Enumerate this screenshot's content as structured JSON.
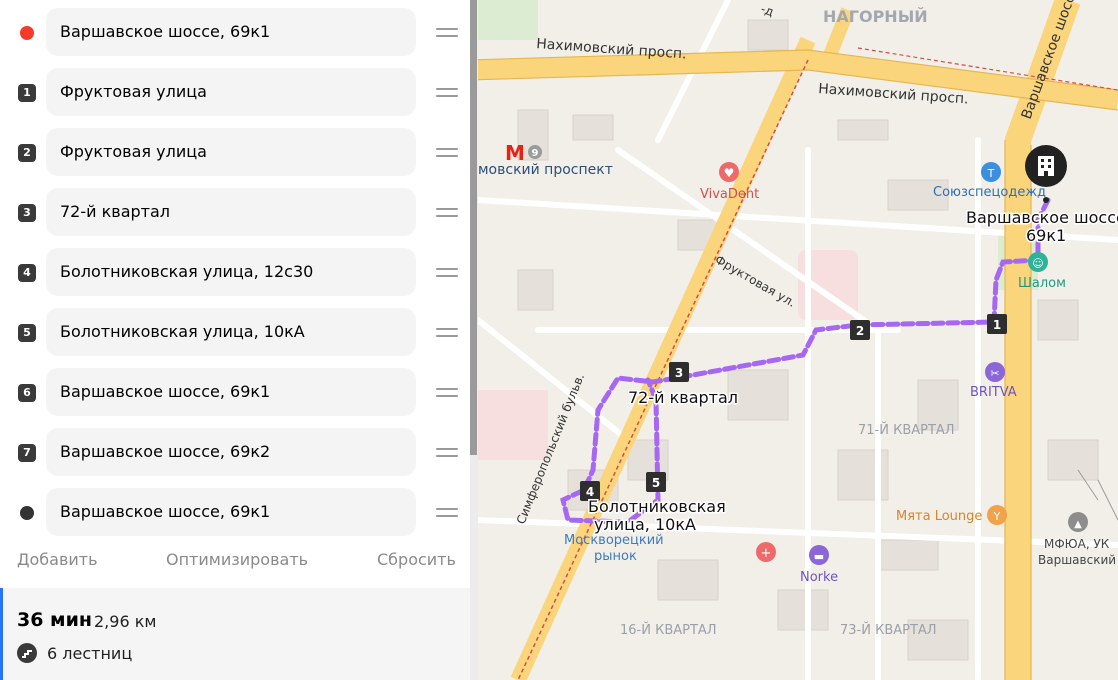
{
  "route_panel": {
    "stops": [
      {
        "marker": "",
        "kind": "start",
        "value": "Варшавское шоссе, 69к1"
      },
      {
        "marker": "1",
        "kind": "waypoint",
        "value": "Фруктовая улица"
      },
      {
        "marker": "2",
        "kind": "waypoint",
        "value": "Фруктовая улица"
      },
      {
        "marker": "3",
        "kind": "waypoint",
        "value": "72-й квартал"
      },
      {
        "marker": "4",
        "kind": "waypoint",
        "value": "Болотниковская улица, 12с30"
      },
      {
        "marker": "5",
        "kind": "waypoint",
        "value": "Болотниковская улица, 10кА"
      },
      {
        "marker": "6",
        "kind": "waypoint",
        "value": "Варшавское шоссе, 69к1"
      },
      {
        "marker": "7",
        "kind": "waypoint",
        "value": "Варшавское шоссе, 69к2"
      },
      {
        "marker": "",
        "kind": "end",
        "value": "Варшавское шоссе, 69к1"
      }
    ],
    "actions": {
      "add": "Добавить",
      "optimize": "Оптимизировать",
      "reset": "Сбросить"
    },
    "summary": {
      "time": "36 мин",
      "distance": "2,96 км",
      "stairs": "6 лестниц"
    }
  },
  "map": {
    "district_labels": [
      "НАГОРНЫЙ",
      "71-Й КВАРТАЛ",
      "16-Й КВАРТАЛ",
      "73-Й КВАРТАЛ"
    ],
    "streets": [
      "Нахимовский просп.",
      "Нахимовский просп.",
      "Варшавское шоссе",
      "Фруктовая ул.",
      "Симферопольский бульв.",
      "-д"
    ],
    "metro": {
      "line": "9",
      "name": "мовский проспект"
    },
    "pois": [
      "VivaDent",
      "Союзспецодежд",
      "Шалом",
      "BRITVA",
      "Мята Lounge",
      "Norke",
      "МФЮА, УК",
      "Варшавский",
      "Москворецкий",
      "рынок"
    ],
    "route_labels": {
      "start_line1": "Варшавское шоссе",
      "start_line2": "69к1",
      "stop3": "72-й квартал",
      "stop5_line1": "Болотниковская",
      "stop5_line2": "улица, 10кА"
    },
    "route_markers": [
      "1",
      "2",
      "3",
      "4",
      "5"
    ],
    "colors": {
      "route": "#a668f2",
      "major_road": "#fbd57b",
      "start": "#f43b2b",
      "accent": "#2c72f5"
    }
  }
}
